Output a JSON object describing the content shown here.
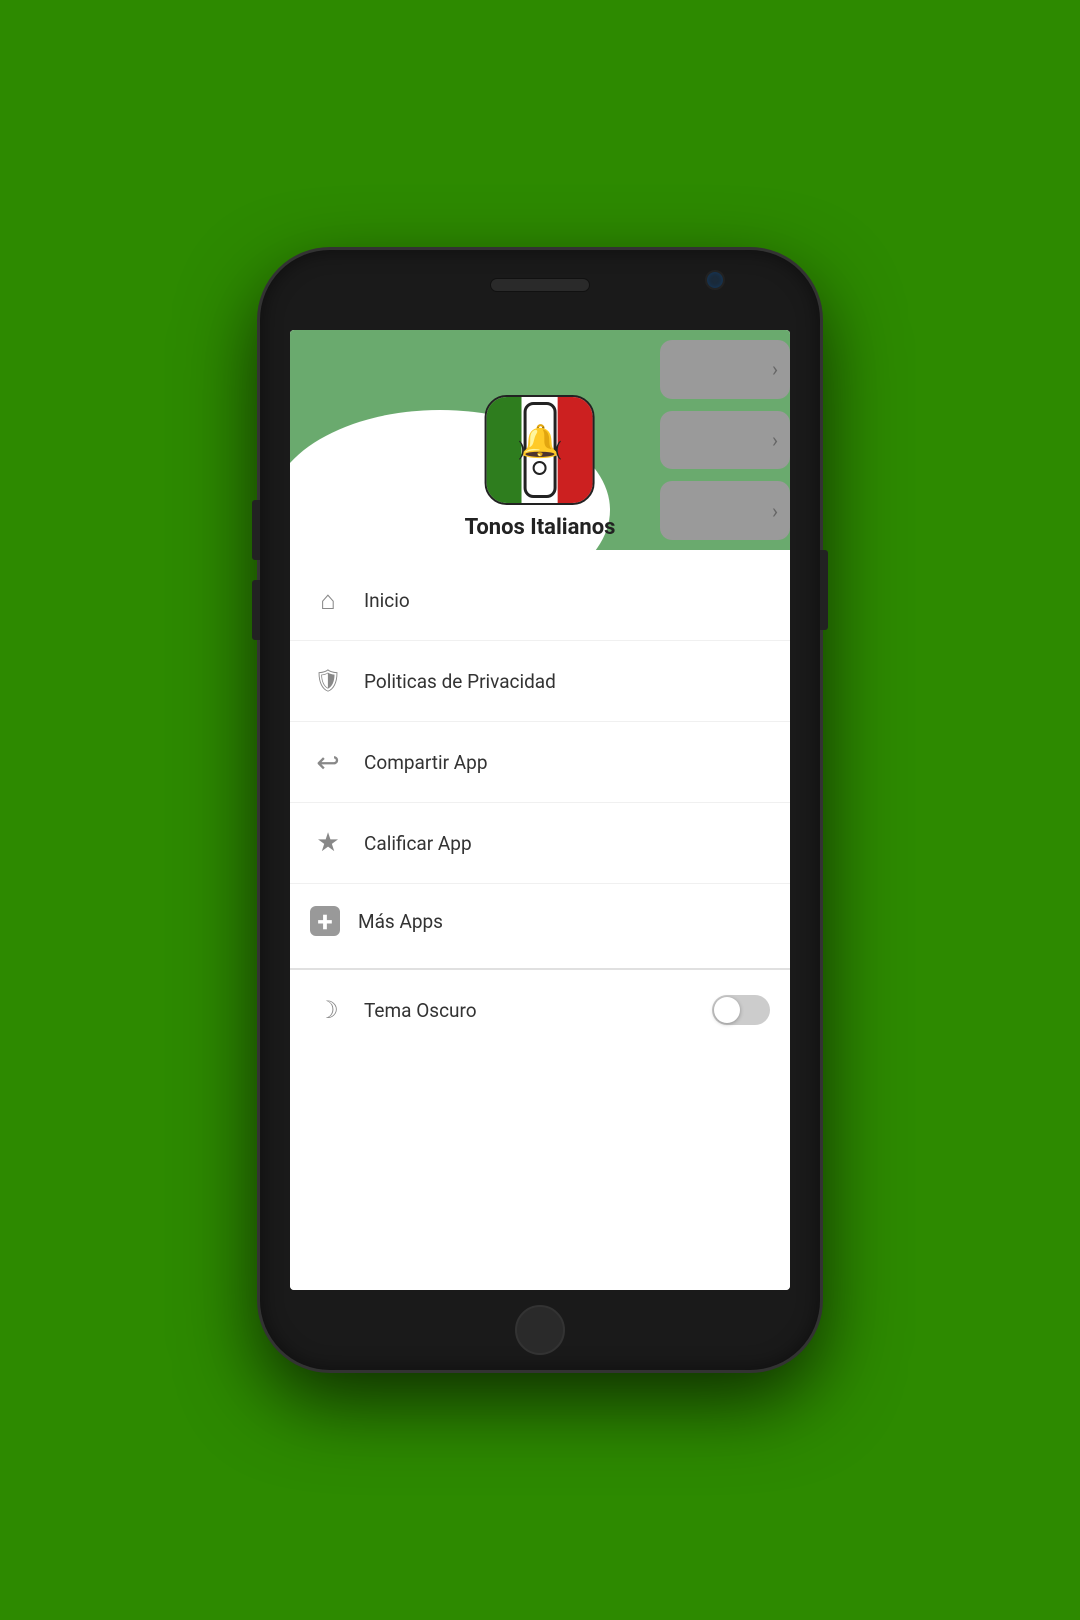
{
  "phone": {
    "background_color": "#2d8a00"
  },
  "app": {
    "title": "Tonos Italianos",
    "header_bg": "#6aaa6e",
    "menu_items": [
      {
        "id": "inicio",
        "label": "Inicio",
        "icon": "home",
        "icon_char": "⌂"
      },
      {
        "id": "politicas",
        "label": "Politicas de Privacidad",
        "icon": "shield",
        "icon_char": "🛡"
      },
      {
        "id": "compartir",
        "label": "Compartir App",
        "icon": "share",
        "icon_char": "↪"
      },
      {
        "id": "calificar",
        "label": "Calificar App",
        "icon": "star",
        "icon_char": "★"
      },
      {
        "id": "mas-apps",
        "label": "Más Apps",
        "icon": "plus-box",
        "icon_char": "⊞"
      }
    ],
    "toggle": {
      "label": "Tema Oscuro",
      "icon_char": "☽",
      "enabled": false
    },
    "right_cards": [
      {
        "chevron": "›"
      },
      {
        "chevron": "›"
      },
      {
        "chevron": "›"
      },
      {
        "chevron": "›"
      },
      {
        "chevron": "›"
      },
      {
        "chevron": "›"
      },
      {
        "chevron": "›"
      },
      {
        "chevron": "›"
      }
    ]
  }
}
